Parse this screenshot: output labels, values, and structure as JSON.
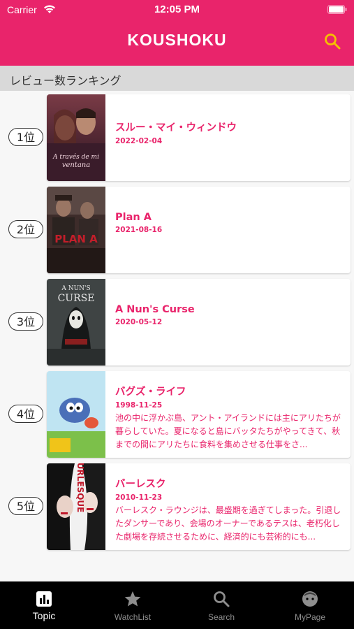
{
  "status_bar": {
    "carrier": "Carrier",
    "time": "12:05 PM"
  },
  "header": {
    "title": "KOUSHOKU"
  },
  "section": {
    "title": "レビュー数ランキング"
  },
  "rankings": [
    {
      "rank": "1位",
      "title": "スルー・マイ・ウィンドウ",
      "date": "2022-02-04",
      "description": ""
    },
    {
      "rank": "2位",
      "title": "Plan A",
      "date": "2021-08-16",
      "description": ""
    },
    {
      "rank": "3位",
      "title": "A Nun's Curse",
      "date": "2020-05-12",
      "description": ""
    },
    {
      "rank": "4位",
      "title": "バグズ・ライフ",
      "date": "1998-11-25",
      "description": "池の中に浮かぶ島、アント・アイランドには主にアリたちが暮らしていた。夏になると島にバッタたちがやってきて、秋までの間にアリたちに食料を集めさせる仕事をさ..."
    },
    {
      "rank": "5位",
      "title": "バーレスク",
      "date": "2010-11-23",
      "description": "バーレスク・ラウンジは、最盛期を過ぎてしまった。引退したダンサーであり、会場のオーナーであるテスは、老朽化した劇場を存続させるために、経済的にも芸術的にも..."
    }
  ],
  "tabs": [
    {
      "label": "Topic",
      "icon": "chart-icon",
      "active": true
    },
    {
      "label": "WatchList",
      "icon": "star-icon",
      "active": false
    },
    {
      "label": "Search",
      "icon": "search-icon",
      "active": false
    },
    {
      "label": "MyPage",
      "icon": "face-icon",
      "active": false
    }
  ],
  "colors": {
    "accent": "#e9246b",
    "search_icon": "#f5c000",
    "tabbar": "#000000"
  }
}
